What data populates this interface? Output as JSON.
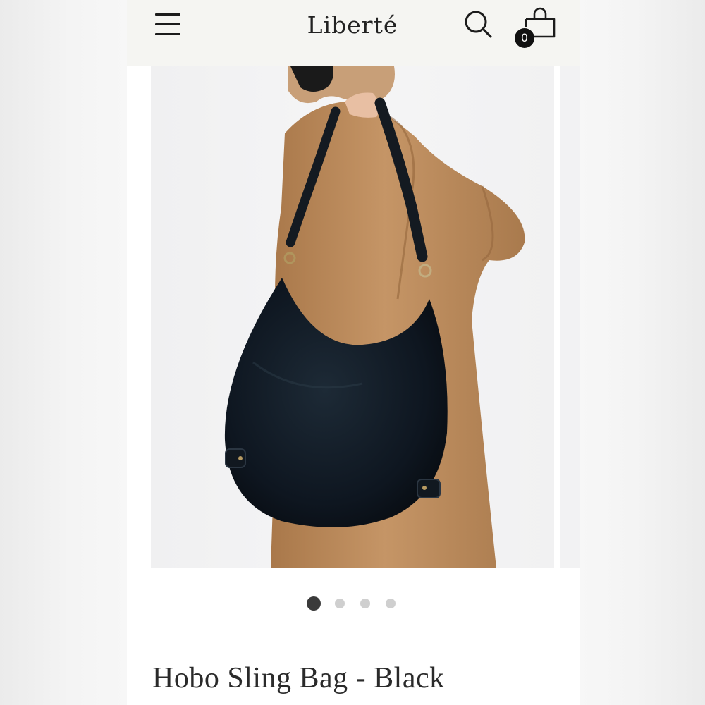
{
  "header": {
    "brand": "Liberté",
    "cart_count": "0",
    "icons": {
      "menu": "hamburger-menu-icon",
      "search": "search-icon",
      "cart": "shopping-bag-icon"
    }
  },
  "gallery": {
    "image": "woman-in-camel-coat-carrying-black-leather-hobo-bag",
    "slides_total": 4,
    "active_slide": 1
  },
  "product": {
    "title": "Hobo Sling Bag - Black"
  },
  "colors": {
    "header_bg": "#f5f5f2",
    "dot_active": "#3a3a3a",
    "dot_inactive": "#cfcfcf",
    "text": "#2a2a2a"
  }
}
